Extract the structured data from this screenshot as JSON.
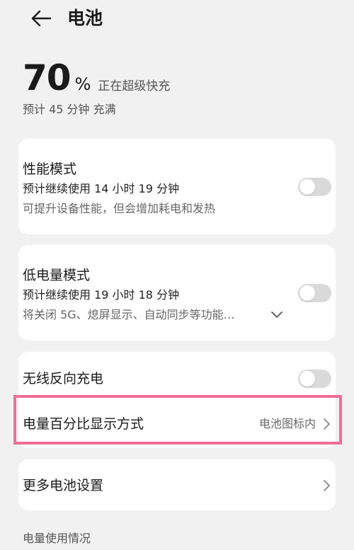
{
  "header": {
    "title": "电池"
  },
  "summary": {
    "percent": "70",
    "unit": "%",
    "status": "正在超级快充",
    "eta": "预计 45 分钟 充满"
  },
  "performance_mode": {
    "title": "性能模式",
    "estimate": "预计继续使用 14 小时 19 分钟",
    "description": "可提升设备性能，但会增加耗电和发热",
    "enabled": false
  },
  "low_power_mode": {
    "title": "低电量模式",
    "estimate": "预计继续使用 19 小时 18 分钟",
    "description": "将关闭 5G、熄屏显示、自动同步等功能…",
    "enabled": false
  },
  "wireless_reverse_charging": {
    "title": "无线反向充电",
    "enabled": false
  },
  "battery_percentage_display": {
    "title": "电量百分比显示方式",
    "value": "电池图标内"
  },
  "more_settings": {
    "title": "更多电池设置"
  },
  "usage_section": {
    "label": "电量使用情况"
  },
  "colors": {
    "background": "#f1f1f1",
    "card": "#ffffff",
    "toggle_off": "#dadada",
    "highlight": "#ef6d95"
  }
}
